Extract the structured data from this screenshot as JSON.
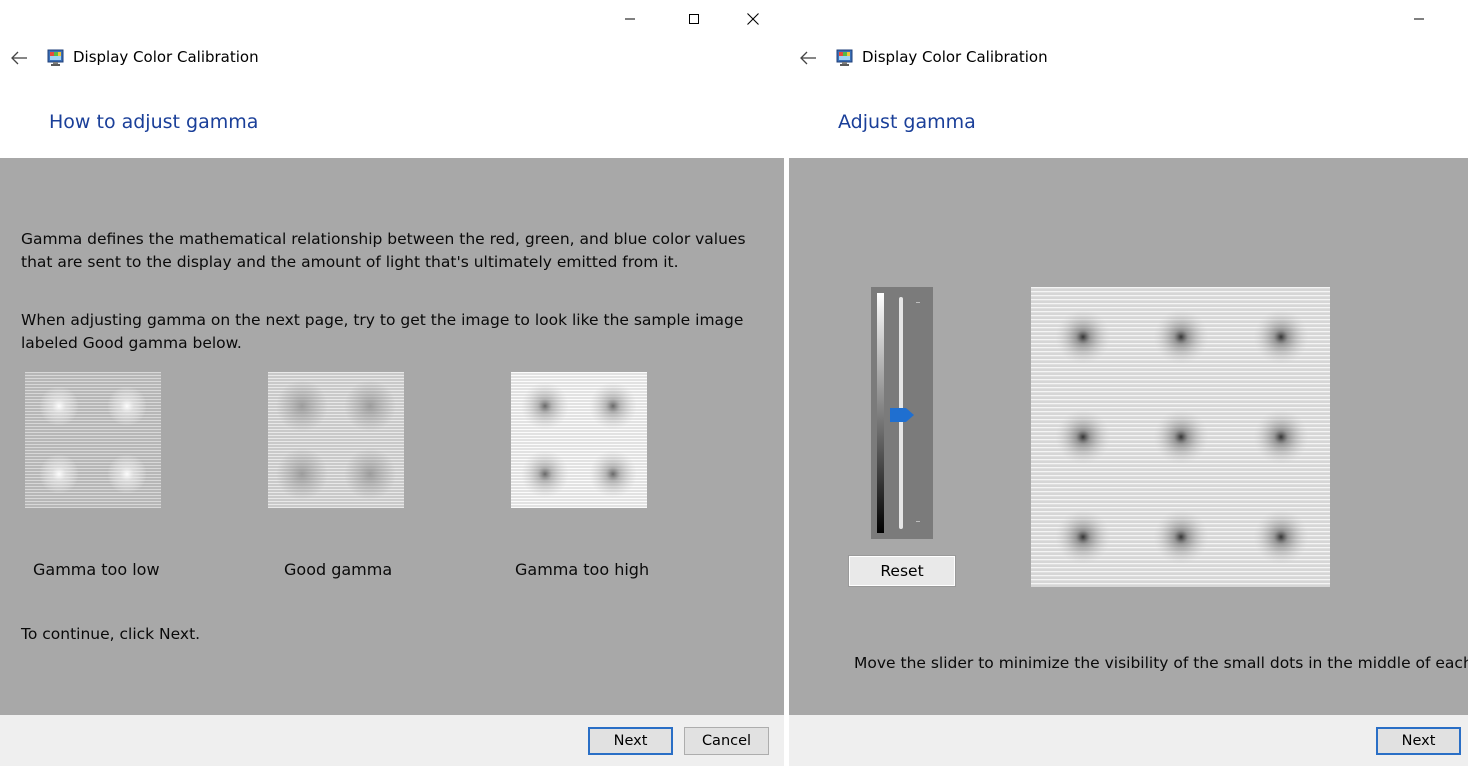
{
  "left_window": {
    "app_title": "Display Color Calibration",
    "heading": "How to adjust gamma",
    "paragraph1": "Gamma defines the mathematical relationship between the red, green, and blue color values that are sent to the display and the amount of light that's ultimately emitted from it.",
    "paragraph2": "When adjusting gamma on the next page, try to get the image to look like the sample image labeled Good gamma below.",
    "samples": [
      {
        "label": "Gamma too low"
      },
      {
        "label": "Good gamma"
      },
      {
        "label": "Gamma too high"
      }
    ],
    "continue_text": "To continue, click Next.",
    "next_label": "Next",
    "cancel_label": "Cancel"
  },
  "right_window": {
    "app_title": "Display Color Calibration",
    "heading": "Adjust gamma",
    "reset_label": "Reset",
    "instruction": "Move the slider to minimize the visibility of the small dots in the middle of each c",
    "next_label": "Next",
    "gamma_slider_level": 0.5
  },
  "colors": {
    "heading": "#1a3f99",
    "content_bg": "#a8a8a8",
    "footer_bg": "#efefef",
    "primary_border": "#2a6fc6",
    "slider_thumb": "#1f6fd0"
  },
  "icons": [
    "back-arrow-icon",
    "display-calibration-icon",
    "minimize-icon",
    "maximize-icon",
    "close-icon"
  ]
}
